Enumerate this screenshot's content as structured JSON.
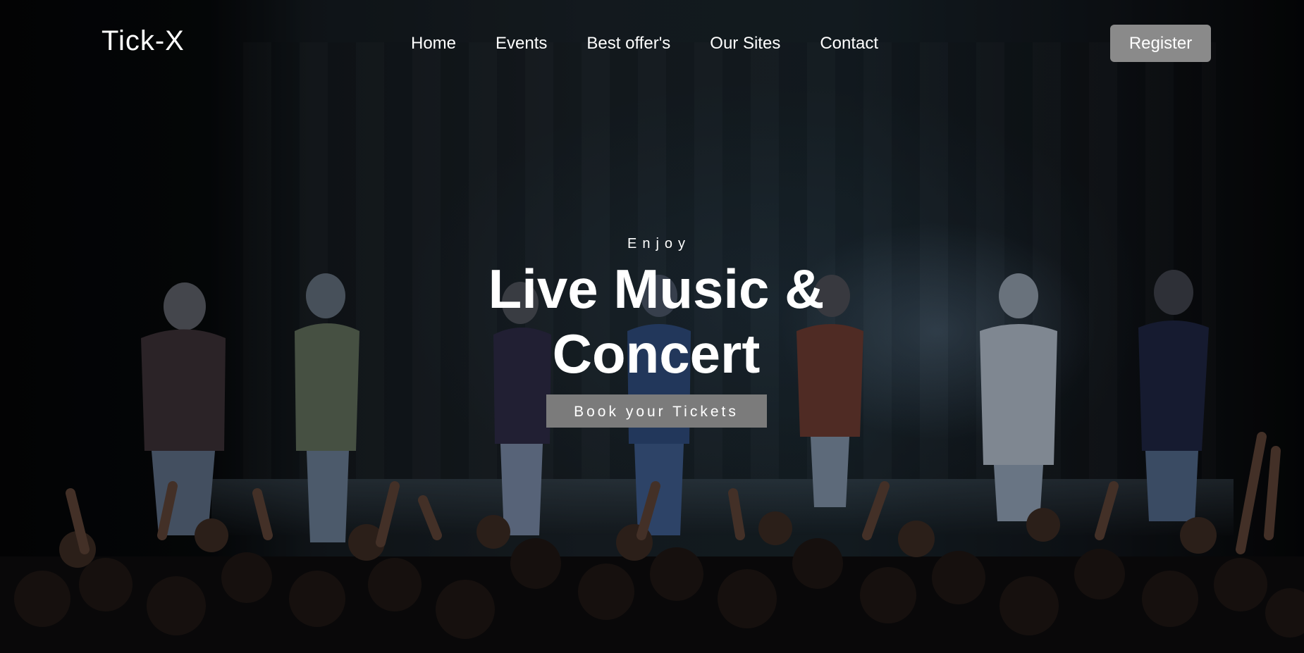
{
  "brand": {
    "logo": "Tick-X"
  },
  "nav": {
    "items": [
      {
        "label": "Home"
      },
      {
        "label": "Events"
      },
      {
        "label": "Best offer's"
      },
      {
        "label": "Our Sites"
      },
      {
        "label": "Contact"
      }
    ],
    "register_label": "Register"
  },
  "hero": {
    "eyebrow": "Enjoy",
    "headline_line1": "Live Music &",
    "headline_line2": "Concert",
    "cta_label": "Book your Tickets"
  },
  "colors": {
    "button_gray": "#8a8a8a",
    "cta_gray": "#7b7b7b",
    "text": "#ffffff"
  }
}
